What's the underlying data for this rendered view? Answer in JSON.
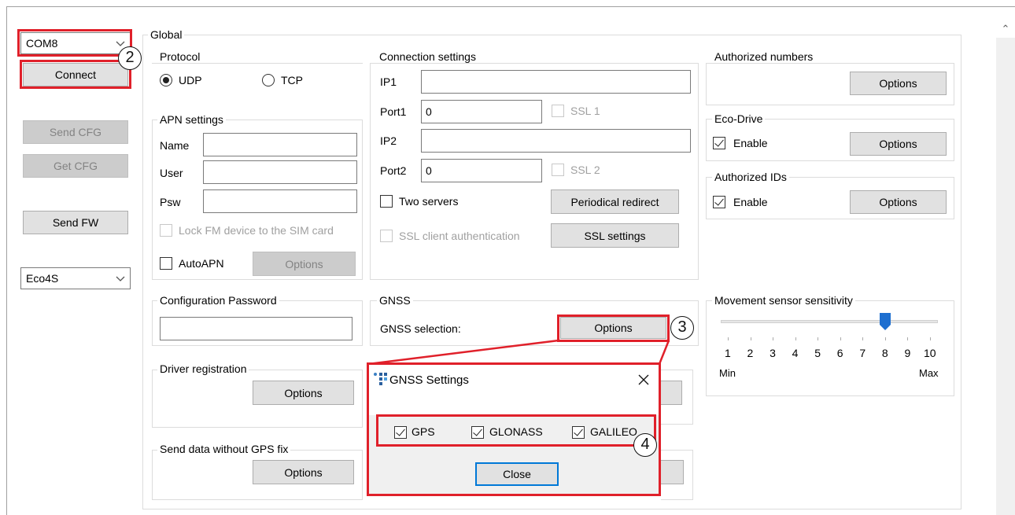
{
  "left_panel": {
    "port_select": "COM8",
    "connect_label": "Connect",
    "send_cfg_label": "Send CFG",
    "get_cfg_label": "Get CFG",
    "send_fw_label": "Send FW",
    "device_select": "Eco4S"
  },
  "global": {
    "title": "Global",
    "protocol": {
      "title": "Protocol",
      "udp": "UDP",
      "tcp": "TCP",
      "selected": "UDP"
    },
    "apn": {
      "title": "APN settings",
      "name_label": "Name",
      "user_label": "User",
      "psw_label": "Psw",
      "name_value": "",
      "user_value": "",
      "psw_value": "",
      "lock_label": "Lock FM device to the SIM card",
      "autoapn_label": "AutoAPN",
      "options_label": "Options"
    },
    "connection": {
      "title": "Connection settings",
      "ip1_label": "IP1",
      "ip1_value": "",
      "port1_label": "Port1",
      "port1_value": "0",
      "ssl1_label": "SSL 1",
      "ip2_label": "IP2",
      "ip2_value": "",
      "port2_label": "Port2",
      "port2_value": "0",
      "ssl2_label": "SSL 2",
      "two_servers_label": "Two servers",
      "periodical_redirect_label": "Periodical redirect",
      "ssl_client_auth_label": "SSL client authentication",
      "ssl_settings_label": "SSL settings"
    },
    "authorized_numbers": {
      "title": "Authorized numbers",
      "options_label": "Options"
    },
    "eco_drive": {
      "title": "Eco-Drive",
      "enable_label": "Enable",
      "options_label": "Options"
    },
    "authorized_ids": {
      "title": "Authorized IDs",
      "enable_label": "Enable",
      "options_label": "Options"
    },
    "config_password": {
      "title": "Configuration Password",
      "value": ""
    },
    "gnss": {
      "title": "GNSS",
      "selection_label": "GNSS selection:",
      "options_label": "Options"
    },
    "driver_registration": {
      "title": "Driver registration",
      "options_label": "Options"
    },
    "send_without_fix": {
      "title": "Send data without GPS fix",
      "options_label": "Options"
    },
    "movement_sensor": {
      "title": "Movement sensor sensitivity",
      "value": 8,
      "min_value": 1,
      "max_value": 10,
      "scale": [
        "1",
        "2",
        "3",
        "4",
        "5",
        "6",
        "7",
        "8",
        "9",
        "10"
      ],
      "min_label": "Min",
      "max_label": "Max"
    }
  },
  "gnss_dialog": {
    "title": "GNSS Settings",
    "gps_label": "GPS",
    "glonass_label": "GLONASS",
    "galileo_label": "GALILEO",
    "close_label": "Close"
  },
  "callouts": {
    "c2": "2",
    "c3": "3",
    "c4": "4"
  },
  "colors": {
    "highlight": "#e0202a",
    "accent": "#0078d7",
    "thumb": "#1e6fd0"
  }
}
